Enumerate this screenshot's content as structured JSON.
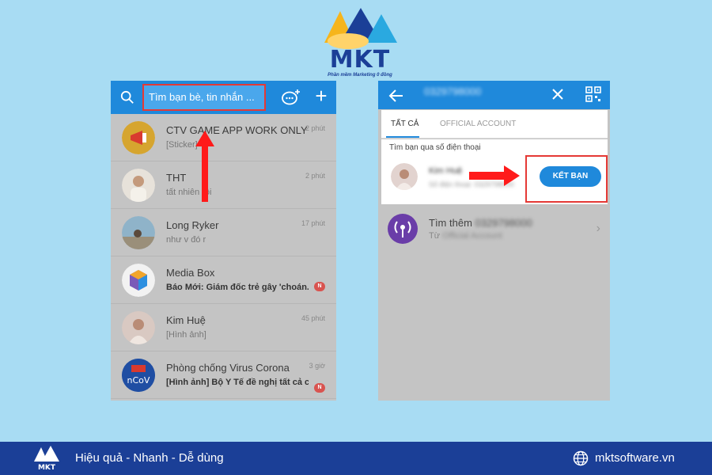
{
  "brand": {
    "logo_text": "MKT",
    "tagline": "Phần mềm Marketing 0 đồng"
  },
  "left_phone": {
    "search_placeholder": "Tìm bạn bè, tin nhắn ...",
    "conversations": [
      {
        "name": "CTV GAME APP WORK ONLY",
        "message": "[Sticker]",
        "time": "2 phút",
        "unread": false,
        "bold": false
      },
      {
        "name": "THT",
        "message": "tất nhiên rồi",
        "time": "2 phút",
        "unread": false,
        "bold": false
      },
      {
        "name": "Long Ryker",
        "message": "như v đó r",
        "time": "17 phút",
        "unread": false,
        "bold": false
      },
      {
        "name": "Media Box",
        "message": "Báo Mới: Giám đốc trẻ gây 'choán...",
        "time": "",
        "unread": true,
        "badge": "N",
        "bold": true
      },
      {
        "name": "Kim Huệ",
        "message": "[Hình ảnh]",
        "time": "45 phút",
        "unread": false,
        "bold": false
      },
      {
        "name": "Phòng chống Virus Corona",
        "message": "[Hình ảnh] Bộ Y Tế đề nghị tất cả c...",
        "time": "3 giờ",
        "unread": true,
        "badge": "N",
        "bold": true,
        "avatar_text": "nCoV"
      }
    ]
  },
  "right_phone": {
    "search_query": "0329798000",
    "tabs": [
      {
        "label": "TẤT CẢ",
        "active": true
      },
      {
        "label": "OFFICIAL ACCOUNT",
        "active": false
      }
    ],
    "section_label": "Tìm bạn qua số điện thoại",
    "result": {
      "name": "Kim Huệ",
      "subtitle": "Số điện thoại: 0329798000"
    },
    "add_friend_label": "KẾT BẠN",
    "more": {
      "title_prefix": "Tìm thêm",
      "title_query": "0329798000",
      "subtitle_prefix": "Từ",
      "subtitle_rest": "Official Account"
    }
  },
  "footer": {
    "slogan": "Hiệu quả - Nhanh - Dễ dùng",
    "website": "mktsoftware.vn"
  },
  "colors": {
    "background": "#a8dcf3",
    "zalo_blue": "#1f89db",
    "highlight_red": "#e53935",
    "footer_blue": "#1b3f97"
  }
}
